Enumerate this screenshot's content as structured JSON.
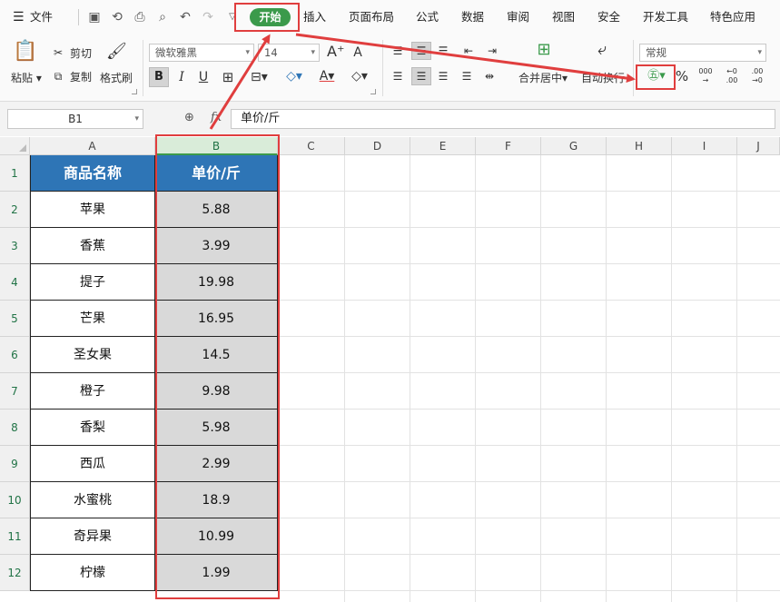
{
  "menu": {
    "file": "文件",
    "tabs": [
      "开始",
      "插入",
      "页面布局",
      "公式",
      "数据",
      "审阅",
      "视图",
      "安全",
      "开发工具",
      "特色应用"
    ]
  },
  "ribbon": {
    "paste": "粘贴",
    "cut": "剪切",
    "copy": "复制",
    "format_painter": "格式刷",
    "font_name": "微软雅黑",
    "font_size": "14",
    "merge_center": "合并居中",
    "wrap_text": "自动换行",
    "number_format": "常规",
    "percent": "%",
    "thousands": "000",
    "inc_decimal": ".00",
    "dec_decimal": ".00"
  },
  "formula_bar": {
    "cell_ref": "B1",
    "fx": "fx",
    "content": "单价/斤"
  },
  "columns": [
    "A",
    "B",
    "C",
    "D",
    "E",
    "F",
    "G",
    "H",
    "I",
    "J"
  ],
  "rows": [
    "1",
    "2",
    "3",
    "4",
    "5",
    "6",
    "7",
    "8",
    "9",
    "10",
    "11",
    "12"
  ],
  "table": {
    "headers": [
      "商品名称",
      "单价/斤"
    ],
    "rows": [
      [
        "苹果",
        "5.88"
      ],
      [
        "香蕉",
        "3.99"
      ],
      [
        "提子",
        "19.98"
      ],
      [
        "芒果",
        "16.95"
      ],
      [
        "圣女果",
        "14.5"
      ],
      [
        "橙子",
        "9.98"
      ],
      [
        "香梨",
        "5.98"
      ],
      [
        "西瓜",
        "2.99"
      ],
      [
        "水蜜桃",
        "18.9"
      ],
      [
        "奇异果",
        "10.99"
      ],
      [
        "柠檬",
        "1.99"
      ]
    ]
  },
  "colors": {
    "accent_green": "#3b9a4b",
    "header_blue": "#2e75b6",
    "highlight_red": "#e03e3e"
  }
}
